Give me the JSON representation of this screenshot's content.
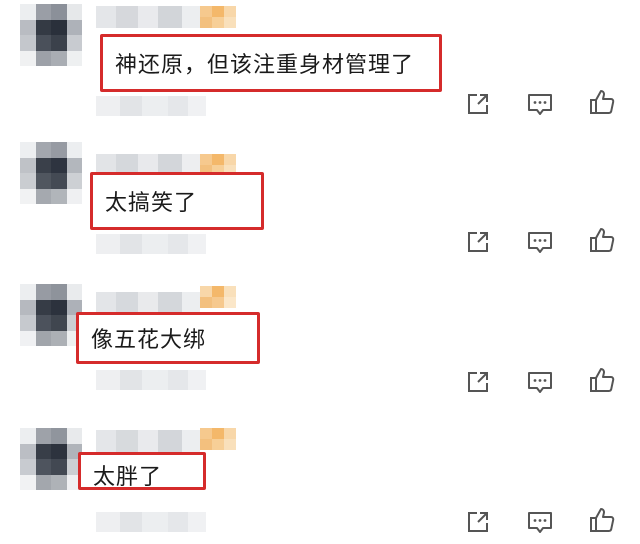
{
  "comments": [
    {
      "text": "神还原，但该注重身材管理了",
      "actions": [
        "share-icon",
        "reply-icon",
        "like-icon"
      ]
    },
    {
      "text": "太搞笑了",
      "actions": [
        "share-icon",
        "reply-icon",
        "like-icon"
      ]
    },
    {
      "text": "像五花大绑",
      "actions": [
        "share-icon",
        "reply-icon",
        "like-icon"
      ]
    },
    {
      "text": "太胖了",
      "actions": [
        "share-icon",
        "reply-icon",
        "like-icon"
      ]
    }
  ],
  "colors": {
    "highlight_border": "#d52b2b",
    "icon": "#555555"
  }
}
